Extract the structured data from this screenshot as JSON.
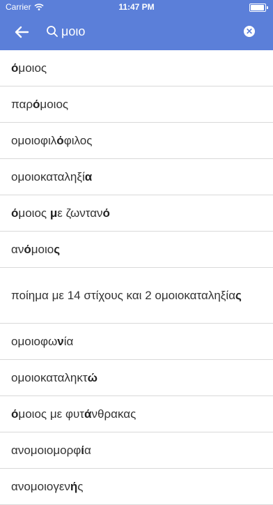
{
  "status": {
    "carrier": "Carrier",
    "time": "11:47 PM"
  },
  "search": {
    "query": "μοιο"
  },
  "results": [
    [
      "ό",
      "μοιος"
    ],
    [
      "παρ",
      "ό",
      "μοιος"
    ],
    [
      "ομοιοφιλ",
      "ό",
      "φιλος"
    ],
    [
      "ομοιοκαταληξ",
      "ί",
      "α"
    ],
    [
      "ό",
      "μοιος με ζωντανό"
    ],
    [
      "αν",
      "ό",
      "μοιος"
    ],
    [
      "ποίημα με 14 στίχους και 2 ομοιοκαταληξί",
      "ας"
    ],
    [
      "ομοιοφων",
      "ί",
      "α"
    ],
    [
      "ομοιοκαταληκτ",
      "ώ"
    ],
    [
      "ό",
      "μοιος με φυτ",
      "ά",
      "νθρακας"
    ],
    [
      "ανομοιομορφ",
      "ί",
      "α"
    ],
    [
      "ανομοιογενής"
    ]
  ],
  "results_text": [
    "όμοιος",
    "παρόμοιος",
    "ομοιοφιλόφιλος",
    "ομοιοκαταληξία",
    "όμοιος με ζωντανό",
    "ανόμοιος",
    "ποίημα με 14 στίχους και 2 ομοιοκαταληξίας",
    "ομοιοφωνία",
    "ομοιοκαταληκτώ",
    "όμοιος με φυτάνθρακας",
    "ανομοιομορφία",
    "ανομοιογενής"
  ],
  "colors": {
    "header_bg": "#5b7fd9",
    "divider": "#d9d9d9"
  }
}
